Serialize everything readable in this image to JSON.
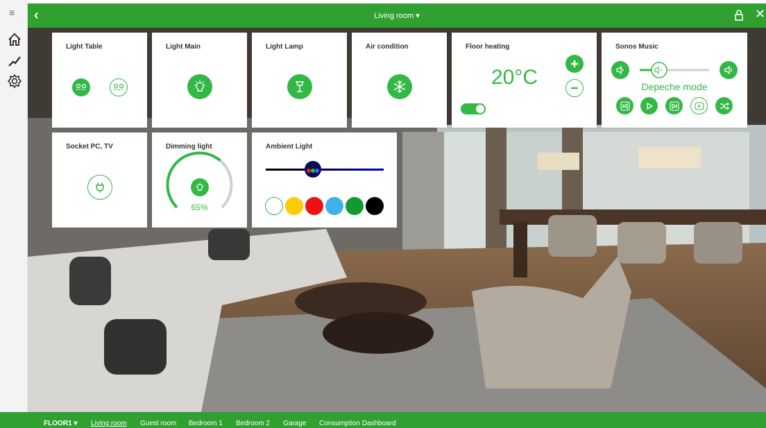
{
  "header": {
    "title": "Living room ▾",
    "back_icon": "chevron-left-icon",
    "lock_icon": "lock-icon",
    "close_icon": "close-icon"
  },
  "sidebar": {
    "items": [
      {
        "icon": "menu-icon"
      },
      {
        "icon": "home-icon"
      },
      {
        "icon": "chart-icon"
      },
      {
        "icon": "gear-icon"
      }
    ]
  },
  "cards": {
    "light_table": {
      "title": "Light Table"
    },
    "light_main": {
      "title": "Light Main"
    },
    "light_lamp": {
      "title": "Light Lamp"
    },
    "air_condition": {
      "title": "Air condition"
    },
    "floor_heating": {
      "title": "Floor heating",
      "temperature": "20°C",
      "toggle_on": true
    },
    "sonos": {
      "title": "Sonos Music",
      "track": "Depeche mode",
      "volume_level": 0.28
    },
    "socket": {
      "title": "Socket PC, TV"
    },
    "dimming": {
      "title": "Dimming light",
      "percent": "65%",
      "level": 0.65
    },
    "ambient": {
      "title": "Ambient Light",
      "slider_level": 0.4,
      "swatches": [
        "#ffffff",
        "#ffcc00",
        "#ee1111",
        "#3cb2e8",
        "#119933",
        "#000000"
      ]
    }
  },
  "footer": {
    "floor": "FLOOR1 ▾",
    "links": [
      "Living room",
      "Guest room",
      "Bedroom 1",
      "Bedroom 2",
      "Garage",
      "Consumption Dashboard"
    ],
    "active": "Living room"
  },
  "colors": {
    "brand": "#30a130",
    "accent": "#33b845"
  }
}
